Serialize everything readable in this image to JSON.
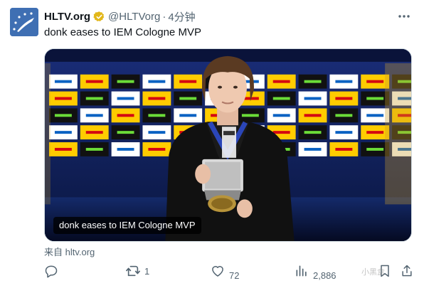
{
  "tweet": {
    "author": {
      "display_name": "HLTV.org",
      "handle": "@HLTVorg",
      "separator": "·",
      "time": "4分钟",
      "verified": true,
      "verified_color": "#e2b719"
    },
    "text": "donk eases to IEM Cologne MVP",
    "media": {
      "caption": "donk eases to IEM Cologne MVP",
      "sponsor_boards": [
        "intel",
        "DHL",
        "MONSTER"
      ]
    },
    "source": "来自 hltv.org",
    "actions": {
      "reply_count": "",
      "retweet_count": "1",
      "like_count": "72",
      "view_count": "2,886"
    }
  },
  "watermark": "小黑盒",
  "icons": {
    "avatar": "hltv-logo-icon",
    "verified": "verified-badge-icon",
    "more": "more-dots-icon",
    "reply": "reply-icon",
    "retweet": "retweet-icon",
    "like": "heart-icon",
    "views": "views-chart-icon",
    "bookmark": "bookmark-icon",
    "share": "share-icon"
  },
  "colors": {
    "text_primary": "#0f1419",
    "text_secondary": "#536471",
    "avatar_bg": "#3f6fb3"
  }
}
